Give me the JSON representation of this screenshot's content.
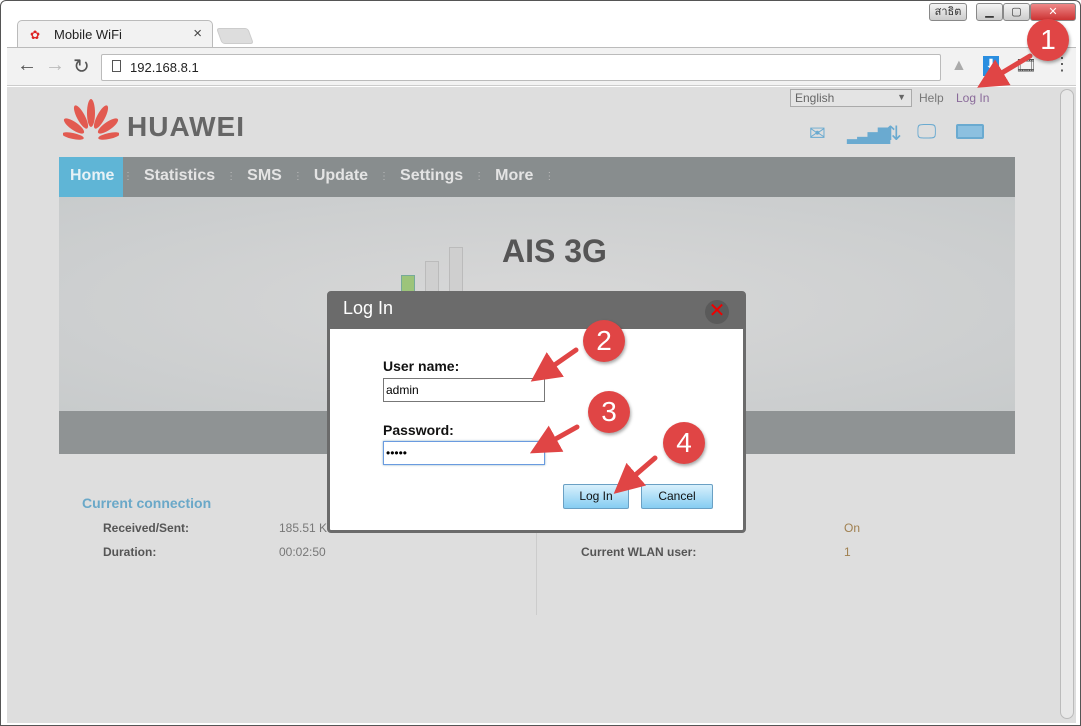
{
  "browser": {
    "tab_title": "Mobile WiFi",
    "url": "192.168.8.1",
    "window_buttons": [
      "สาธิต",
      "minimize",
      "restore",
      "close"
    ]
  },
  "topbar": {
    "language": "English",
    "help": "Help",
    "login": "Log In"
  },
  "brand": {
    "name": "HUAWEI",
    "color": "#e25a50"
  },
  "status_icons": [
    "mail-icon",
    "signal-icon",
    "data-transfer-icon",
    "wifi-display-icon",
    "battery-icon"
  ],
  "menu": {
    "items": [
      "Home",
      "Statistics",
      "SMS",
      "Update",
      "Settings",
      "More"
    ],
    "active": "Home",
    "active_color": "#5fb5d6"
  },
  "banner": {
    "carrier": "AIS 3G",
    "signal_level": 1,
    "signal_max": 3
  },
  "connection": {
    "title": "Current connection",
    "rows": [
      {
        "label": "Received/Sent:",
        "value": "185.51 K"
      },
      {
        "label": "Duration:",
        "value": "00:02:50"
      }
    ],
    "right_rows": [
      {
        "label": "",
        "value": "On"
      },
      {
        "label": "Current WLAN user:",
        "value": "1"
      }
    ]
  },
  "dialog": {
    "title": "Log In",
    "username_label": "User name:",
    "username_value": "admin",
    "password_label": "Password:",
    "password_value": "•••••",
    "login_button": "Log In",
    "cancel_button": "Cancel"
  },
  "annotations": {
    "steps": [
      "1",
      "2",
      "3",
      "4"
    ],
    "color": "#e04545"
  }
}
